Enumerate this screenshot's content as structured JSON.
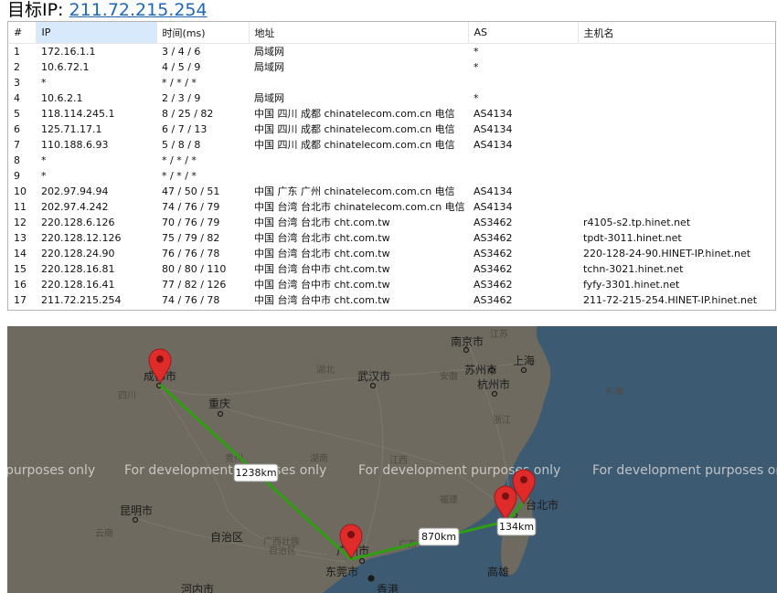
{
  "title": {
    "label": "目标IP:",
    "ip": "211.72.215.254"
  },
  "table": {
    "columns": [
      "#",
      "IP",
      "时间(ms)",
      "地址",
      "AS",
      "主机名"
    ],
    "rows": [
      [
        "1",
        "172.16.1.1",
        "3 / 4 / 6",
        "局域网",
        "*",
        ""
      ],
      [
        "2",
        "10.6.72.1",
        "4 / 5 / 9",
        "局域网",
        "*",
        ""
      ],
      [
        "3",
        "*",
        "* / * / *",
        "",
        "",
        ""
      ],
      [
        "4",
        "10.6.2.1",
        "2 / 3 / 9",
        "局域网",
        "*",
        ""
      ],
      [
        "5",
        "118.114.245.1",
        "8 / 25 / 82",
        "中国 四川 成都 chinatelecom.com.cn 电信",
        "AS4134",
        ""
      ],
      [
        "6",
        "125.71.17.1",
        "6 / 7 / 13",
        "中国 四川 成都 chinatelecom.com.cn 电信",
        "AS4134",
        ""
      ],
      [
        "7",
        "110.188.6.93",
        "5 / 8 / 8",
        "中国 四川 成都 chinatelecom.com.cn 电信",
        "AS4134",
        ""
      ],
      [
        "8",
        "*",
        "* / * / *",
        "",
        "",
        ""
      ],
      [
        "9",
        "*",
        "* / * / *",
        "",
        "",
        ""
      ],
      [
        "10",
        "202.97.94.94",
        "47 / 50 / 51",
        "中国 广东 广州 chinatelecom.com.cn 电信",
        "AS4134",
        ""
      ],
      [
        "11",
        "202.97.4.242",
        "74 / 76 / 79",
        "中国 台湾 台北市 chinatelecom.com.cn 电信",
        "AS4134",
        ""
      ],
      [
        "12",
        "220.128.6.126",
        "70 / 76 / 79",
        "中国 台湾 台北市 cht.com.tw",
        "AS3462",
        "r4105-s2.tp.hinet.net"
      ],
      [
        "13",
        "220.128.12.126",
        "75 / 79 / 82",
        "中国 台湾 台北市 cht.com.tw",
        "AS3462",
        "tpdt-3011.hinet.net"
      ],
      [
        "14",
        "220.128.24.90",
        "76 / 76 / 78",
        "中国 台湾 台北市 cht.com.tw",
        "AS3462",
        "220-128-24-90.HINET-IP.hinet.net"
      ],
      [
        "15",
        "220.128.16.81",
        "80 / 80 / 110",
        "中国 台湾 台中市 cht.com.tw",
        "AS3462",
        "tchn-3021.hinet.net"
      ],
      [
        "16",
        "220.128.16.41",
        "77 / 82 / 126",
        "中国 台湾 台中市 cht.com.tw",
        "AS3462",
        "fyfy-3301.hinet.net"
      ],
      [
        "17",
        "211.72.215.254",
        "74 / 76 / 78",
        "中国 台湾 台中市 cht.com.tw",
        "AS3462",
        "211-72-215-254.HINET-IP.hinet.net"
      ]
    ]
  },
  "map": {
    "watermarks": [
      "purposes only",
      "For development purposes only",
      "For development purposes only",
      "For development purposes only"
    ],
    "cities": [
      "南京市",
      "上海",
      "苏州市",
      "杭州市",
      "武汉市",
      "成都市",
      "重庆",
      "安徽",
      "湖北",
      "江苏",
      "浙江",
      "东海",
      "四川",
      "湖南",
      "江西",
      "福建",
      "昆明市",
      "云南",
      "贵州",
      "广西壮族",
      "自治区",
      "广东",
      "广州市",
      "东莞市",
      "香港",
      "河内市",
      "台北市",
      "高雄"
    ],
    "distances": [
      "1238km",
      "870km",
      "134km"
    ],
    "colors": {
      "route": "#2f9e10",
      "marker": "#e02b2b",
      "land": "#6e6a5f",
      "sea": "#3d5a73"
    }
  }
}
